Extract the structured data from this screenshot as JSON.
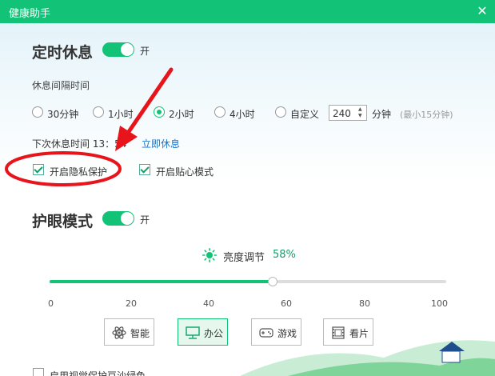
{
  "window": {
    "title": "健康助手",
    "close_glyph": "✕"
  },
  "rest": {
    "title": "定时休息",
    "toggle_label": "开",
    "interval_label": "休息间隔时间",
    "options": [
      {
        "label": "30分钟",
        "checked": false
      },
      {
        "label": "1小时",
        "checked": false
      },
      {
        "label": "2小时",
        "checked": true
      },
      {
        "label": "4小时",
        "checked": false
      },
      {
        "label": "自定义",
        "checked": false
      }
    ],
    "custom_value": "240",
    "custom_unit": "分钟",
    "custom_hint": "(最小15分钟)",
    "next_rest_label": "下次休息时间 13：54",
    "rest_now_link": "立即休息",
    "privacy_label": "开启隐私保护",
    "caring_label": "开启贴心模式"
  },
  "eye": {
    "title": "护眼模式",
    "toggle_label": "开",
    "brightness_label": "亮度调节",
    "brightness_value": "58%",
    "brightness_percent": 58,
    "ticks": [
      "0",
      "20",
      "40",
      "60",
      "80",
      "100"
    ],
    "modes": [
      {
        "label": "智能",
        "icon": "atom-icon",
        "active": false
      },
      {
        "label": "办公",
        "icon": "monitor-icon",
        "active": true
      },
      {
        "label": "游戏",
        "icon": "gamepad-icon",
        "active": false
      },
      {
        "label": "看片",
        "icon": "film-icon",
        "active": false
      }
    ],
    "bottom_label": "启用视觉保护豆沙绿色"
  },
  "colors": {
    "accent": "#11c277",
    "link": "#1a73c8",
    "annotation": "#e8141b"
  }
}
